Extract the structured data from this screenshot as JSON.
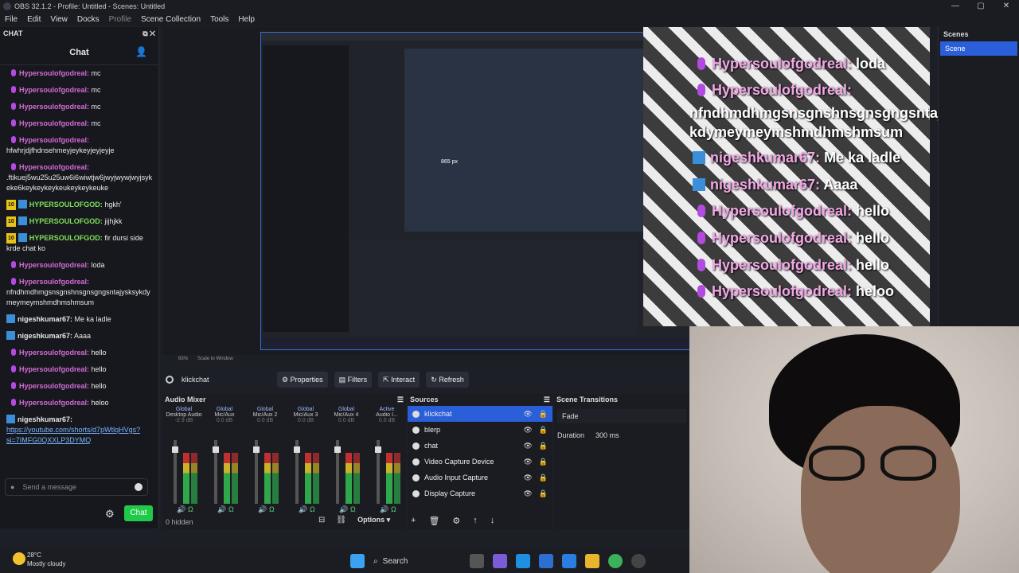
{
  "window": {
    "title": "OBS 32.1.2 - Profile: Untitled - Scenes: Untitled"
  },
  "menu": [
    "File",
    "Edit",
    "View",
    "Docks",
    "Profile",
    "Scene Collection",
    "Tools",
    "Help"
  ],
  "chat_dock": {
    "dock_title": "CHAT",
    "header": "Chat",
    "send_placeholder": "Send a message",
    "chat_button": "Chat",
    "messages": [
      {
        "name": "Hypersoulofgodreal:",
        "text": "mc",
        "kind": "mic"
      },
      {
        "name": "Hypersoulofgodreal:",
        "text": "mc",
        "kind": "mic"
      },
      {
        "name": "Hypersoulofgodreal:",
        "text": "mc",
        "kind": "mic"
      },
      {
        "name": "Hypersoulofgodreal:",
        "text": "mc",
        "kind": "mic"
      },
      {
        "name": "Hypersoulofgodreal:",
        "text": "hfwhrjdjfhdnsehmeyjeykeyjeyjeyje",
        "kind": "mic",
        "block": true
      },
      {
        "name": "Hypersoulofgodreal:",
        "text": ".ftikuej5wu25u25uw6i6wiwtjw6jwyjwywjwyjsykeke6keykeykeykeukeykeykeuke",
        "kind": "mic",
        "block": true
      },
      {
        "name": "HYPERSOULOFGOD:",
        "text": "hgkh'",
        "kind": "tw"
      },
      {
        "name": "HYPERSOULOFGOD:",
        "text": "jijhjkk",
        "kind": "tw"
      },
      {
        "name": "HYPERSOULOFGOD:",
        "text": "fir dursi side krde chat ko",
        "kind": "tw"
      },
      {
        "name": "Hypersoulofgodreal:",
        "text": "loda",
        "kind": "mic"
      },
      {
        "name": "Hypersoulofgodreal:",
        "text": "nfndhmdhmgsnsgnshnsgnsgngsntajysksykdymeymeymshmdhmshmsum",
        "kind": "mic",
        "block": true
      },
      {
        "name": "nigeshkumar67:",
        "text": "Me ka ladle",
        "kind": "pr"
      },
      {
        "name": "nigeshkumar67:",
        "text": "Aaaa",
        "kind": "pr"
      },
      {
        "name": "Hypersoulofgodreal:",
        "text": "hello",
        "kind": "mic"
      },
      {
        "name": "Hypersoulofgodreal:",
        "text": "hello",
        "kind": "mic"
      },
      {
        "name": "Hypersoulofgodreal:",
        "text": "hello",
        "kind": "mic"
      },
      {
        "name": "Hypersoulofgodreal:",
        "text": "heloo",
        "kind": "mic"
      },
      {
        "name": "nigeshkumar67:",
        "text": "https://youtube.com/shorts/d7pWtlqHVgs?si=7IMFG0QXXLP3DYMQ",
        "kind": "pr",
        "block": true,
        "link": true
      }
    ]
  },
  "badge_label": "10",
  "overlay": [
    {
      "name": "Hypersoulofgodreal:",
      "text": "loda",
      "kind": "mic"
    },
    {
      "name": "Hypersoulofgodreal:",
      "text": "",
      "kind": "mic"
    },
    {
      "name": "",
      "text": "nfndhmdhmgsnsgnshnsgnsgngsntajysksy",
      "kind": "none"
    },
    {
      "name": "",
      "text": "kdymeymeymshmdhmshmsum",
      "kind": "none"
    },
    {
      "name": "nigeshkumar67:",
      "text": "Me ka ladle",
      "kind": "pr"
    },
    {
      "name": "nigeshkumar67:",
      "text": "Aaaa",
      "kind": "pr"
    },
    {
      "name": "Hypersoulofgodreal:",
      "text": "hello",
      "kind": "mic"
    },
    {
      "name": "Hypersoulofgodreal:",
      "text": "hello",
      "kind": "mic"
    },
    {
      "name": "Hypersoulofgodreal:",
      "text": "hello",
      "kind": "mic"
    },
    {
      "name": "Hypersoulofgodreal:",
      "text": "heloo",
      "kind": "mic"
    }
  ],
  "inner_label": "865 px",
  "zoom": {
    "value": "83%",
    "mode": "Scale to Window"
  },
  "context_bar": {
    "source": "klickchat",
    "properties": "Properties",
    "filters": "Filters",
    "interact": "Interact",
    "refresh": "Refresh"
  },
  "scenes": {
    "title": "Scenes",
    "items": [
      "Scene"
    ]
  },
  "mixer": {
    "title": "Audio Mixer",
    "hidden": "0 hidden",
    "options": "Options",
    "channels": [
      {
        "scope": "Global",
        "name": "Desktop Audio",
        "db": "-2.9 dB"
      },
      {
        "scope": "Global",
        "name": "Mic/Aux",
        "db": "0.0 dB"
      },
      {
        "scope": "Global",
        "name": "Mic/Aux 2",
        "db": "0.0 dB"
      },
      {
        "scope": "Global",
        "name": "Mic/Aux 3",
        "db": "0.0 dB"
      },
      {
        "scope": "Global",
        "name": "Mic/Aux 4",
        "db": "0.0 dB"
      },
      {
        "scope": "Active",
        "name": "Audio I...",
        "db": "0.0 dB"
      }
    ]
  },
  "sources": {
    "title": "Sources",
    "items": [
      "klickchat",
      "blerp",
      "chat",
      "Video Capture Device",
      "Audio Input Capture",
      "Display Capture"
    ]
  },
  "transitions": {
    "title": "Scene Transitions",
    "type": "Fade",
    "duration_label": "Duration",
    "duration_value": "300 ms"
  },
  "taskbar": {
    "temp": "28°C",
    "condition": "Mostly cloudy",
    "search": "Search"
  }
}
